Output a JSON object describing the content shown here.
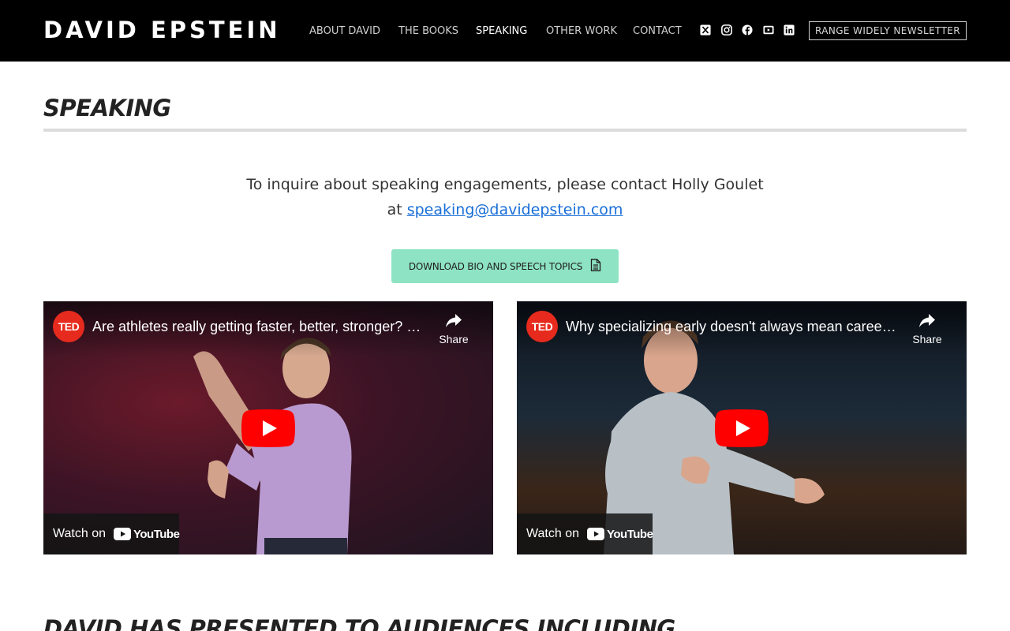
{
  "header": {
    "brand": "DAVID EPSTEIN",
    "nav": [
      {
        "label": "ABOUT DAVID",
        "active": false
      },
      {
        "label": "THE BOOKS",
        "active": false
      },
      {
        "label": "SPEAKING",
        "active": true
      },
      {
        "label": "OTHER WORK",
        "active": false
      },
      {
        "label": "CONTACT",
        "active": false
      }
    ],
    "social_icons": [
      "x-icon",
      "instagram-icon",
      "facebook-icon",
      "youtube-icon",
      "linkedin-icon"
    ],
    "newsletter_label": "RANGE WIDELY NEWSLETTER"
  },
  "main": {
    "title": "SPEAKING",
    "intro_text": "To inquire about speaking engagements, please contact Holly Goulet",
    "intro_at": "at",
    "email": "speaking@davidepstein.com",
    "download_label": "DOWNLOAD BIO AND SPEECH TOPICS",
    "download_icon": "document-icon",
    "videos": [
      {
        "channel_badge": "TED",
        "title": "Are athletes really getting faster, better, stronger? | ...",
        "share_label": "Share",
        "watch_label": "Watch on",
        "yt_text": "YouTube"
      },
      {
        "channel_badge": "TED",
        "title": "Why specializing early doesn't always mean career s...",
        "share_label": "Share",
        "watch_label": "Watch on",
        "yt_text": "YouTube"
      }
    ],
    "section_title": "DAVID HAS PRESENTED TO AUDIENCES INCLUDING"
  },
  "colors": {
    "header_bg": "#000000",
    "button_bg": "#8ee3c4",
    "link": "#1a6fd8",
    "ted_red": "#e62b1e",
    "yt_red": "#ff0000"
  }
}
